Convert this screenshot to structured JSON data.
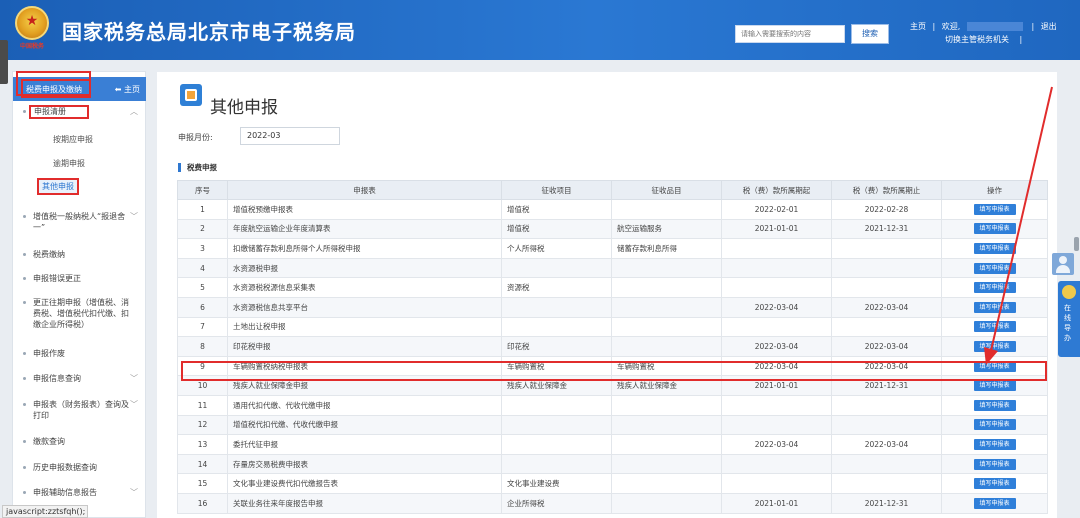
{
  "header": {
    "site_title": "国家税务总局北京市电子税务局",
    "emblem_motto": "中国税务",
    "search_placeholder": "请输入需要搜索的内容",
    "search_label": "搜索",
    "home_link": "主页",
    "welcome_text": "欢迎,",
    "logout_link": "退出",
    "switch_link": "切换主管税务机关",
    "separator": "|"
  },
  "sidebar": {
    "head_label": "税费申报及缴纳",
    "home_label": "主页",
    "group_label": "申报清册",
    "subs": [
      "按期应申报",
      "逾期申报",
      "其他申报"
    ],
    "items": [
      "增值税一般纳税人“报退舍一”",
      "税费缴纳",
      "申报错误更正",
      "更正往期申报（增值税、消费税、增值税代扣代缴、扣缴企业所得税）",
      "申报作废",
      "申报信息查询",
      "申报表（财务报表）查询及打印",
      "缴款查询",
      "历史申报数据查询",
      "申报辅助信息报告"
    ]
  },
  "status_tip": "javascript:zztsfqh();",
  "main": {
    "page_title": "其他申报",
    "month_label": "申报月份:",
    "month_value": "2022-03",
    "section_title": "税费申报",
    "columns": [
      "序号",
      "申报表",
      "征收项目",
      "征收品目",
      "税（费）款所属期起",
      "税（费）款所属期止",
      "操作"
    ],
    "action_label": "填写申报表",
    "rows": [
      [
        "1",
        "增值税预缴申报表",
        "增值税",
        "",
        "2022-02-01",
        "2022-02-28"
      ],
      [
        "2",
        "年度航空运输企业年度清算表",
        "增值税",
        "航空运输服务",
        "2021-01-01",
        "2021-12-31"
      ],
      [
        "3",
        "扣缴储蓄存款利息所得个人所得税申报",
        "个人所得税",
        "储蓄存款利息所得",
        "",
        ""
      ],
      [
        "4",
        "水资源税申报",
        "",
        "",
        "",
        ""
      ],
      [
        "5",
        "水资源税税源信息采集表",
        "资源税",
        "",
        "",
        ""
      ],
      [
        "6",
        "水资源税信息共享平台",
        "",
        "",
        "2022-03-04",
        "2022-03-04"
      ],
      [
        "7",
        "土地出让税申报",
        "",
        "",
        "",
        ""
      ],
      [
        "8",
        "印花税申报",
        "印花税",
        "",
        "2022-03-04",
        "2022-03-04"
      ],
      [
        "9",
        "车辆购置税纳税申报表",
        "车辆购置税",
        "车辆购置税",
        "2022-03-04",
        "2022-03-04"
      ],
      [
        "10",
        "残疾人就业保障金申报",
        "残疾人就业保障金",
        "残疾人就业保障金",
        "2021-01-01",
        "2021-12-31"
      ],
      [
        "11",
        "通用代扣代缴、代收代缴申报",
        "",
        "",
        "",
        ""
      ],
      [
        "12",
        "增值税代扣代缴、代收代缴申报",
        "",
        "",
        "",
        ""
      ],
      [
        "13",
        "委托代征申报",
        "",
        "",
        "2022-03-04",
        "2022-03-04"
      ],
      [
        "14",
        "存量房交易税费申报表",
        "",
        "",
        "",
        ""
      ],
      [
        "15",
        "文化事业建设费代扣代缴报告表",
        "文化事业建设费",
        "",
        "",
        ""
      ],
      [
        "16",
        "关联业务往来年度报告申报",
        "企业所得税",
        "",
        "2021-01-01",
        "2021-12-31"
      ]
    ]
  },
  "floating": {
    "guide_label": "在线导办"
  },
  "colors": {
    "header_blue": "#2a78d3",
    "accent_blue": "#2f7fd9",
    "highlight_red": "#e12c2c"
  },
  "icons": [
    "national-emblem-icon",
    "home-icon",
    "chevron-down-icon",
    "page-form-icon",
    "avatar-icon",
    "guide-icon"
  ]
}
